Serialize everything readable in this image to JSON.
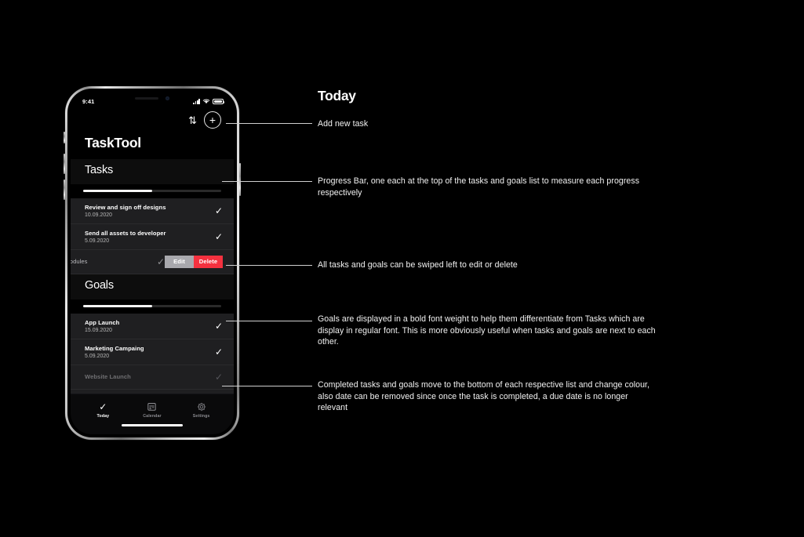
{
  "device": {
    "status_bar": {
      "time": "9:41",
      "signal_icon": "cellular-bars-icon",
      "wifi_icon": "wifi-icon",
      "battery_icon": "battery-full-icon"
    },
    "topbar": {
      "sort_icon": "sort-arrows-icon",
      "sort_glyph": "⇅",
      "add_label": "+",
      "add_name": "add-new-task-button"
    },
    "app_title": "TaskTool",
    "sections": [
      {
        "key": "tasks",
        "header": "Tasks",
        "progress_percent": 50,
        "items": [
          {
            "title": "Review and sign off designs",
            "date": "10.09.2020",
            "check": "✓",
            "state": "open"
          },
          {
            "title": "Send all assets to developer",
            "date": "5.09.2020",
            "check": "✓",
            "state": "open"
          },
          {
            "title": "g modules",
            "date": "",
            "check": "✓",
            "state": "swiped",
            "actions": {
              "edit": "Edit",
              "delete": "Delete"
            }
          }
        ]
      },
      {
        "key": "goals",
        "header": "Goals",
        "progress_percent": 50,
        "items": [
          {
            "title": "App Launch",
            "date": "15.09.2020",
            "check": "✓",
            "state": "open"
          },
          {
            "title": "Marketing Campaing",
            "date": "5.09.2020",
            "check": "✓",
            "state": "open"
          },
          {
            "title": "Website Launch",
            "date": "",
            "check": "✓",
            "state": "done"
          }
        ]
      }
    ],
    "tabbar": [
      {
        "label": "Today",
        "icon": "check-icon",
        "glyph": "✓",
        "active": true
      },
      {
        "label": "Calendar",
        "icon": "calendar-icon",
        "glyph": "",
        "active": false
      },
      {
        "label": "Settings",
        "icon": "gear-icon",
        "glyph": "",
        "active": false
      }
    ]
  },
  "annotations": {
    "title": "Today",
    "notes": [
      "Add new task",
      "Progress Bar, one each at the top of the tasks and goals list to measure each progress respectively",
      "All tasks and goals can be swiped left to edit or delete",
      "Goals are displayed in a bold font weight to help them differentiate from Tasks which are display in regular font. This is more obviously useful when tasks and goals are next to each other.",
      "Completed tasks and goals move to the bottom of each respective list and change colour, also date can be removed since once the task is completed, a due date is no longer relevant"
    ]
  },
  "colors": {
    "background": "#000000",
    "accent_delete": "#f4313f",
    "accent_edit": "#a8a8ad",
    "row_bg": "#1f1f21",
    "text": "#ffffff",
    "muted": "#6f6f72"
  }
}
